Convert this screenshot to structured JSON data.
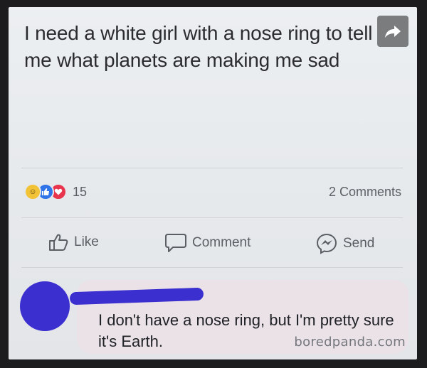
{
  "post": {
    "text": "I need a white girl with a nose ring to tell me what planets are making me sad"
  },
  "icons": {
    "share": "share-arrow-icon",
    "reactions": [
      "haha-reaction-icon",
      "like-reaction-icon",
      "love-reaction-icon"
    ],
    "like": "thumbs-up-icon",
    "comment": "speech-bubble-icon",
    "send": "messenger-icon"
  },
  "stats": {
    "reaction_count": "15",
    "comments_count": "2 Comments"
  },
  "actions": {
    "like": "Like",
    "comment": "Comment",
    "send": "Send"
  },
  "comment": {
    "text": "I don't have a nose ring, but I'm pretty sure it's Earth."
  },
  "watermark": "boredpanda.com",
  "colors": {
    "redaction": "#3b2fd0",
    "like_blue": "#2f74e8",
    "love_red": "#e8344d",
    "haha_yellow": "#f2c337"
  }
}
